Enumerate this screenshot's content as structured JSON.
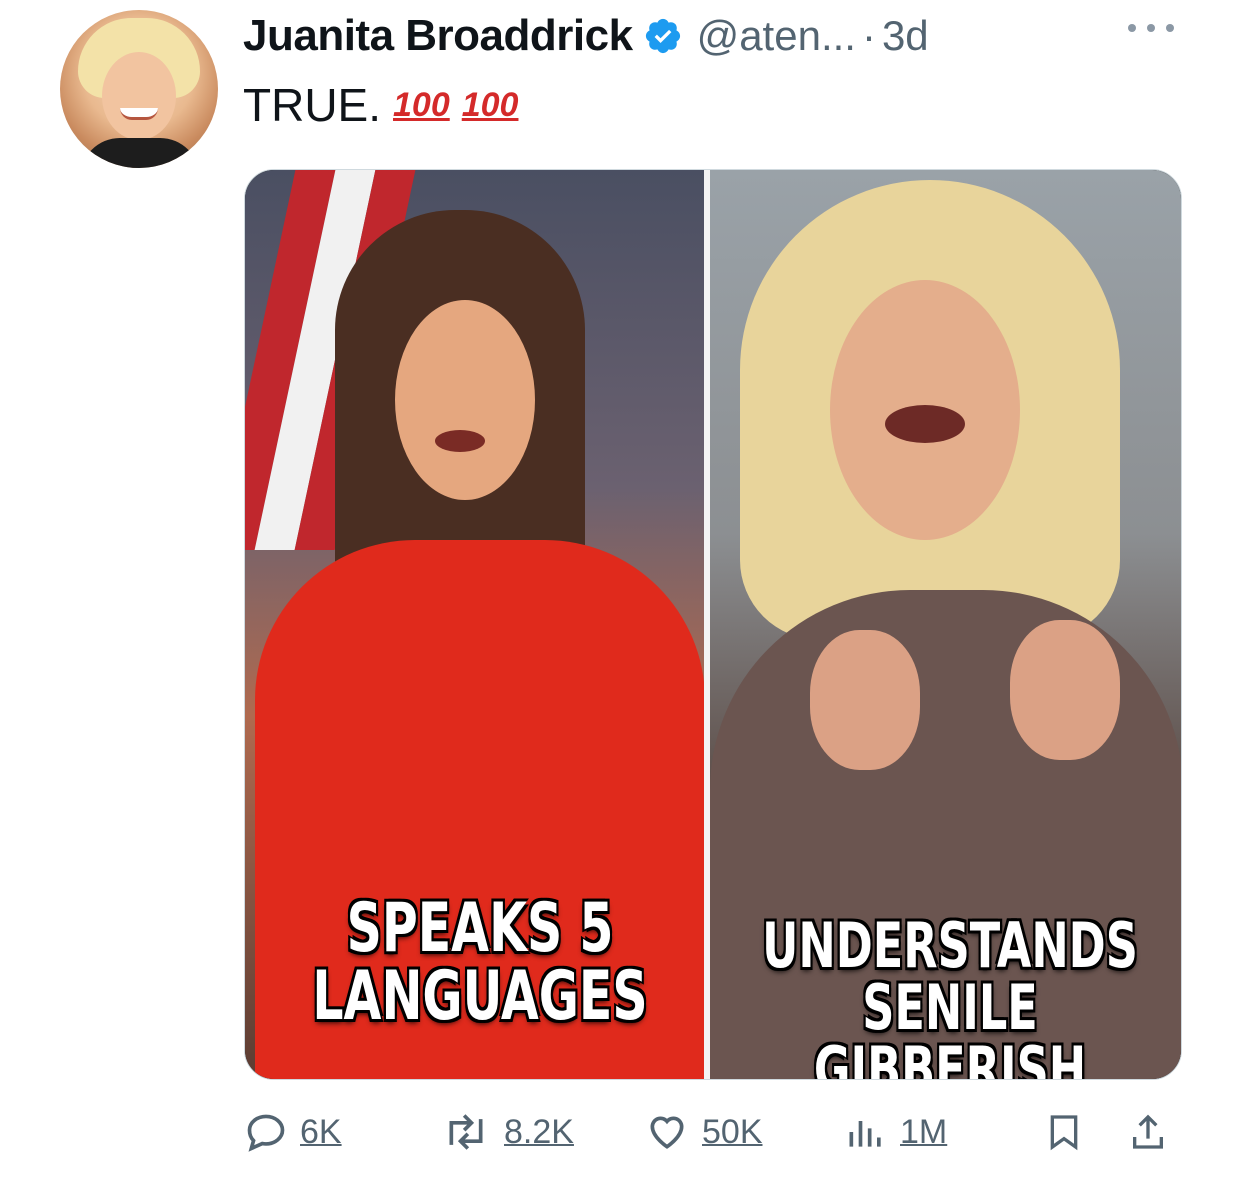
{
  "tweet": {
    "author_name": "Juanita Broaddrick",
    "handle": "@aten...",
    "separator": "·",
    "time": "3d",
    "text": "TRUE.",
    "emojis": [
      "100",
      "100"
    ]
  },
  "media": {
    "left_caption": "SPEAKS 5\nLANGUAGES",
    "right_caption": "UNDERSTANDS\nSENILE GIBBERISH"
  },
  "actions": {
    "replies": "6K",
    "reposts": "8.2K",
    "likes": "50K",
    "views": "1M"
  },
  "icons": {
    "verified": "verified-badge-icon",
    "more": "more-options-icon",
    "reply": "reply-icon",
    "repost": "repost-icon",
    "like": "heart-icon",
    "views": "views-chart-icon",
    "bookmark": "bookmark-icon",
    "share": "share-icon"
  },
  "colors": {
    "verified": "#1d9bf0",
    "secondary_text": "#536471",
    "emoji_red": "#d42a2a"
  }
}
